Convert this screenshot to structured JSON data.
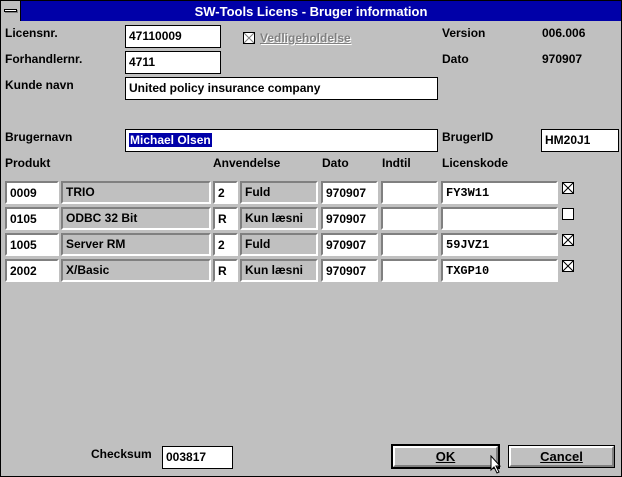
{
  "window": {
    "title": "SW-Tools Licens - Bruger information"
  },
  "header": {
    "licensnr_label": "Licensnr.",
    "licensnr_value": "47110009",
    "forhandlernr_label": "Forhandlernr.",
    "forhandlernr_value": "4711",
    "vedligeholdelse_label": "Vedligeholdelse",
    "version_label": "Version",
    "version_value": "006.006",
    "dato_label": "Dato",
    "dato_value": "970907",
    "kunde_label": "Kunde navn",
    "kunde_value": "United policy insurance company",
    "brugernavn_label": "Brugernavn",
    "brugernavn_value": "Michael Olsen",
    "brugerid_label": "BrugerID",
    "brugerid_value": "HM20J1"
  },
  "table": {
    "headers": {
      "produkt": "Produkt",
      "anvendelse": "Anvendelse",
      "dato": "Dato",
      "indtil": "Indtil",
      "licenskode": "Licenskode"
    },
    "rows": [
      {
        "code": "0009",
        "name": "TRIO",
        "users": "2",
        "use": "Fuld",
        "dato": "970907",
        "indtil": "",
        "licenskode": "FY3W11",
        "checked": true
      },
      {
        "code": "0105",
        "name": "ODBC 32 Bit",
        "users": "R",
        "use": "Kun læsni",
        "dato": "970907",
        "indtil": "",
        "licenskode": "",
        "checked": false
      },
      {
        "code": "1005",
        "name": "Server RM",
        "users": "2",
        "use": "Fuld",
        "dato": "970907",
        "indtil": "",
        "licenskode": "59JVZ1",
        "checked": true
      },
      {
        "code": "2002",
        "name": "X/Basic",
        "users": "R",
        "use": "Kun læsni",
        "dato": "970907",
        "indtil": "",
        "licenskode": "TXGP10",
        "checked": true
      }
    ]
  },
  "footer": {
    "checksum_label": "Checksum",
    "checksum_value": "003817",
    "ok_label": "OK",
    "cancel_label": "Cancel"
  }
}
